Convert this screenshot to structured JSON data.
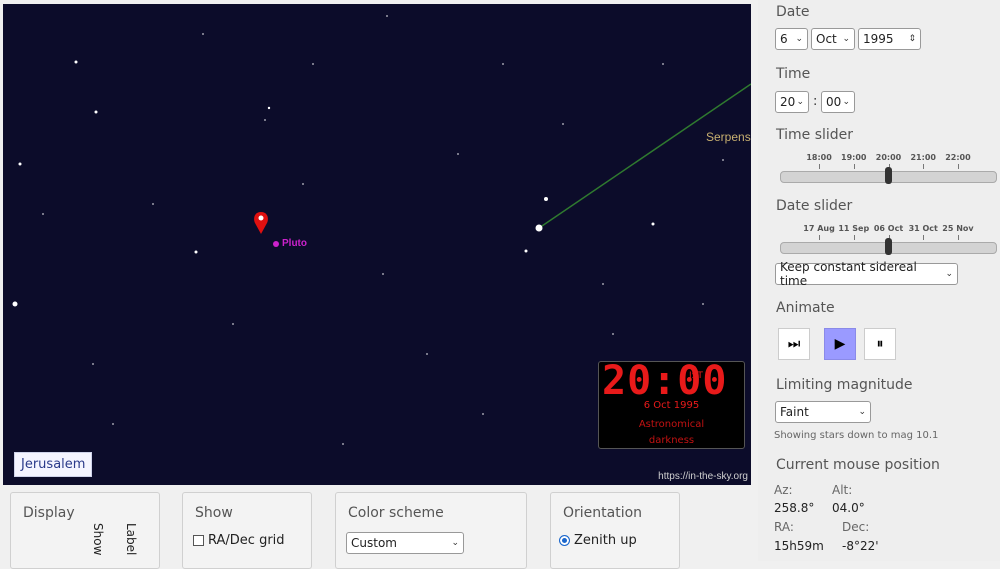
{
  "sky": {
    "location_label": "Jerusalem",
    "planet_label": "Pluto",
    "constellation_label": "Serpens",
    "site_url": "https://in-the-sky.org",
    "clock": {
      "time": "20:00",
      "timezone": "IST",
      "date": "6 Oct 1995",
      "darkness_line1": "Astronomical",
      "darkness_line2": "darkness"
    },
    "colors": {
      "background": "#0c0c2a",
      "pluto": "#cc22cc",
      "marker": "#e01010",
      "line": "#2f7a2f"
    }
  },
  "panel": {
    "date_title": "Date",
    "date_day": "6",
    "date_month": "Oct",
    "date_year": "1995",
    "time_title": "Time",
    "time_hour": "20",
    "time_sep": ":",
    "time_minute": "00",
    "time_slider_title": "Time slider",
    "time_slider_ticks": [
      "18:00",
      "19:00",
      "20:00",
      "21:00",
      "22:00"
    ],
    "time_slider_value_fraction": 0.5,
    "date_slider_title": "Date slider",
    "date_slider_ticks": [
      "17 Aug",
      "11 Sep",
      "06 Oct",
      "31 Oct",
      "25 Nov"
    ],
    "date_slider_value_fraction": 0.5,
    "sidereal_option": "Keep constant sidereal time",
    "animate_title": "Animate",
    "animate_buttons": [
      {
        "name": "skip-forward-icon",
        "glyph": "⏭"
      },
      {
        "name": "play-icon",
        "glyph": "▶"
      },
      {
        "name": "pause-icon",
        "glyph": "⏸"
      }
    ],
    "limiting_mag_title": "Limiting magnitude",
    "limiting_mag_value": "Faint",
    "limiting_mag_note": "Showing stars down to mag 10.1",
    "mouse_title": "Current mouse position",
    "az_label": "Az:",
    "alt_label": "Alt:",
    "az_value": "258.8°",
    "alt_value": "04.0°",
    "ra_label": "RA:",
    "dec_label": "Dec:",
    "ra_value": "15h59m",
    "dec_value": "-8°22'"
  },
  "bottom": {
    "display_title": "Display",
    "display_col_show": "Show",
    "display_col_label": "Label",
    "show_title": "Show",
    "radec_grid_label": "RA/Dec grid",
    "color_scheme_title": "Color scheme",
    "color_scheme_value": "Custom",
    "orientation_title": "Orientation",
    "orientation_value": "Zenith up"
  }
}
